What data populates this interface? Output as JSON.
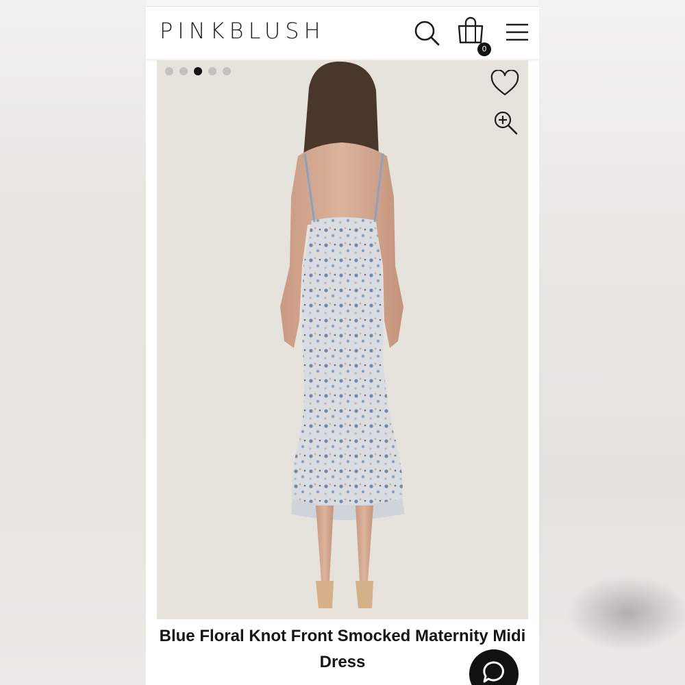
{
  "header": {
    "logo_text": "PINKBLUSH",
    "cart_count": "0",
    "icons": [
      "search-icon",
      "shopping-bag-icon",
      "hamburger-menu-icon"
    ]
  },
  "gallery": {
    "image_count": 5,
    "active_index": 2,
    "icons": [
      "heart-icon",
      "zoom-in-icon"
    ],
    "background_color": "#e6e3dc"
  },
  "product": {
    "title": "Blue Floral Knot Front Smocked Maternity Midi Dress"
  },
  "chat": {
    "icon": "chat-bubble-icon"
  },
  "colors": {
    "brand_text": "#1d1d1d",
    "dark": "#111111"
  }
}
